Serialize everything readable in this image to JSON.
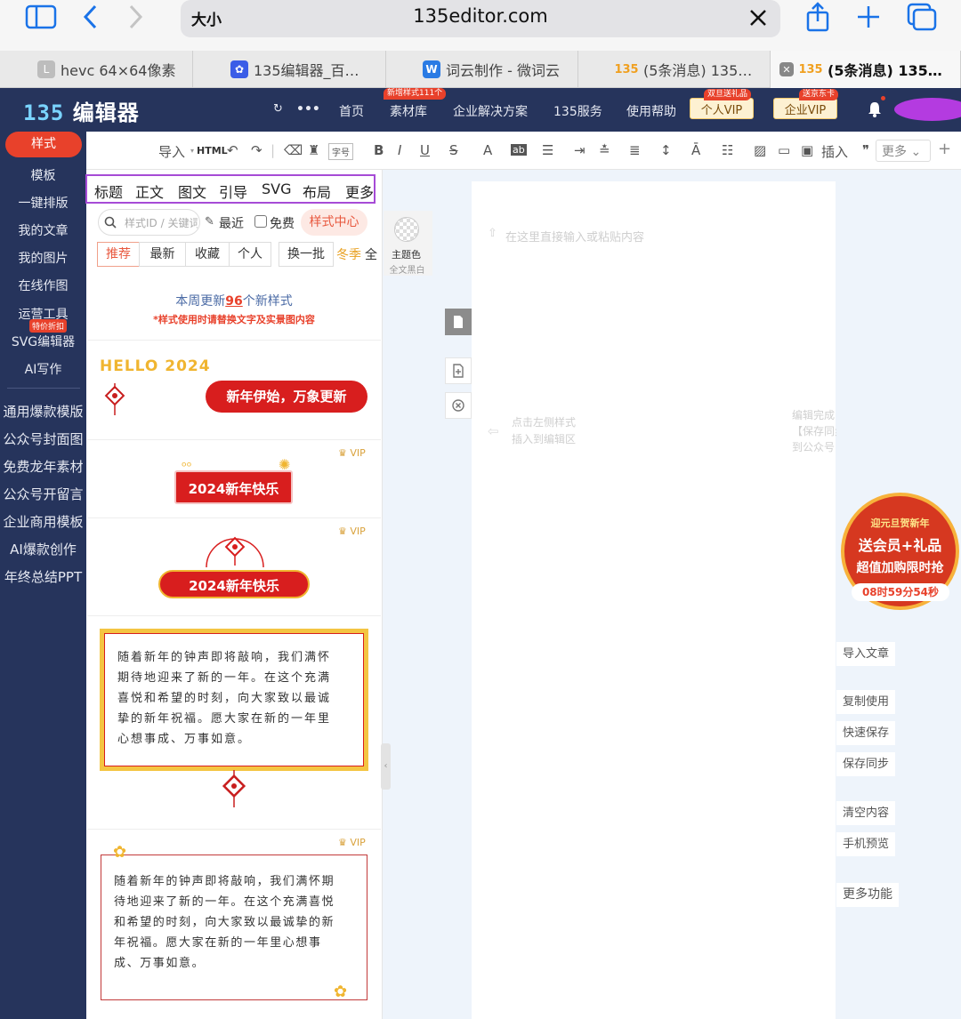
{
  "browser": {
    "text_size_button": "大小",
    "url": "135editor.com",
    "tabs": [
      {
        "label": "hevc 64×64像素",
        "icon_text": "L",
        "icon_color": "#b0b0b0"
      },
      {
        "label": "135编辑器_百…",
        "icon_text": "🐾",
        "icon_color": "#3b5de7"
      },
      {
        "label": "词云制作 - 微词云",
        "icon_text": "W",
        "icon_color": "#2a7be4"
      },
      {
        "label": "(5条消息) 135…",
        "icon_text": "135",
        "icon_color": "#f0a020"
      },
      {
        "label": "(5条消息) 135…",
        "icon_text": "135",
        "icon_color": "#f0a020"
      }
    ]
  },
  "header": {
    "logo_number": "135",
    "logo_text": "编辑器",
    "nav": [
      "首页",
      "素材库",
      "企业解决方案",
      "135服务",
      "使用帮助"
    ],
    "nav_badge": "新增样式111个",
    "vip_personal": "个人VIP",
    "vip_personal_badge": "双旦送礼品",
    "vip_enterprise": "企业VIP",
    "vip_enterprise_badge": "送京东卡"
  },
  "left_nav": {
    "items": [
      "样式",
      "模板",
      "一键排版",
      "我的文章",
      "我的图片",
      "在线作图",
      "运营工具",
      "SVG编辑器",
      "AI写作"
    ],
    "promo_badge": "特价折扣",
    "more": [
      "通用爆款模版",
      "公众号封面图",
      "免费龙年素材",
      "公众号开留言",
      "企业商用模板",
      "AI爆款创作",
      "年终总结PPT"
    ]
  },
  "toolbar": {
    "import": "导入",
    "html": "HTML",
    "font_size": "字号",
    "insert": "插入",
    "more": "更多"
  },
  "style_panel": {
    "categories": [
      "标题",
      "正文",
      "图文",
      "引导",
      "SVG",
      "布局",
      "更多"
    ],
    "search_placeholder": "样式ID / 关键词",
    "recent": "最近",
    "free": "免费",
    "style_center": "样式中心",
    "subtabs": [
      "推荐",
      "最新",
      "收藏",
      "个人",
      "换一批"
    ],
    "season": "冬季",
    "season_cut": "全",
    "theme_color": "主题色",
    "all_black_white": "全文黑白",
    "weekly_prefix": "本周更新",
    "weekly_count": "96",
    "weekly_suffix": "个新样式",
    "weekly_note": "*样式使用时请替换文字及实景图内容",
    "hello": "HELLO 2024",
    "new_year_banner": "新年伊始，万象更新",
    "vip_label": "VIP",
    "happy_new_year_1": "2024新年快乐",
    "happy_new_year_2": "2024新年快乐",
    "paragraph_1": [
      "随着新年的钟声即将敲响，我们满怀",
      "期待地迎来了新的一年。在这个充满",
      "喜悦和希望的时刻，向大家致以最诚",
      "挚的新年祝福。愿大家在新的一年里",
      "心想事成、万事如意。"
    ],
    "paragraph_2": [
      "随着新年的钟声即将敲响，我们满怀期",
      "待地迎来了新的一年。在这个充满喜悦",
      "和希望的时刻，向大家致以最诚挚的新",
      "年祝福。愿大家在新的一年里心想事",
      "成、万事如意。"
    ]
  },
  "canvas": {
    "placeholder": "在这里直接输入或粘贴内容",
    "hint_left": [
      "点击左侧样式",
      "插入到编辑区"
    ],
    "hint_right": [
      "编辑完成",
      "【保存同步",
      "到公众号"
    ]
  },
  "right_actions": [
    "导入文章",
    "复制使用",
    "快速保存",
    "保存同步",
    "清空内容",
    "手机预览",
    "更多功能"
  ],
  "promo": {
    "line1": "迎元旦贺新年",
    "line2": "送会员+礼品",
    "line3": "超值加购限时抢",
    "countdown": "08时59分54秒"
  }
}
